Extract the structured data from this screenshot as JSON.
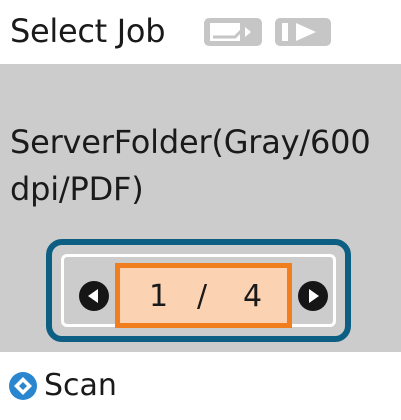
{
  "header": {
    "title": "Select Job",
    "icons": [
      "document-feed-icon",
      "play-icon"
    ]
  },
  "job": {
    "line1": "ServerFolder(Gray/600",
    "line2": "dpi/PDF)"
  },
  "pager": {
    "current": "1",
    "separator": "/",
    "total": "4",
    "prev_icon": "left-arrow-icon",
    "next_icon": "right-arrow-icon"
  },
  "footer": {
    "scan_label": "Scan",
    "scan_icon": "diamond-button-icon"
  },
  "colors": {
    "panel_bg": "#cccccc",
    "frame": "#0c5f82",
    "counter_border": "#f07d1e",
    "counter_fill": "#fbd3b2",
    "scan_icon": "#2a86cf"
  }
}
